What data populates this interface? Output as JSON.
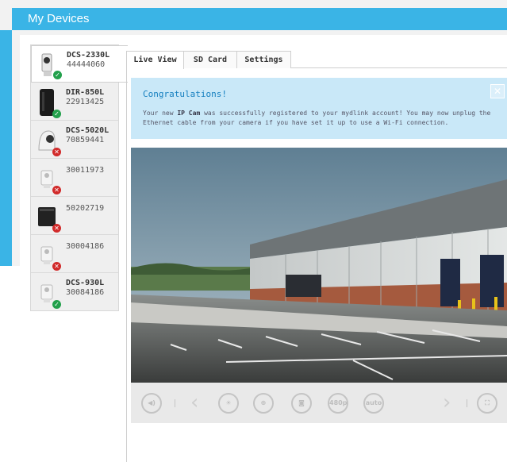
{
  "app": {
    "title": "My Devices"
  },
  "devices": [
    {
      "model": "DCS-2330L",
      "id": "44444060",
      "status": "online",
      "kind": "camera-white",
      "active": true
    },
    {
      "model": "DIR-850L",
      "id": "22913425",
      "status": "online",
      "kind": "router-black"
    },
    {
      "model": "DCS-5020L",
      "id": "70859441",
      "status": "offline",
      "kind": "camera-pt"
    },
    {
      "model": "",
      "id": "30011973",
      "status": "offline",
      "kind": "camera-cube"
    },
    {
      "model": "",
      "id": "50202719",
      "status": "offline",
      "kind": "nas-black"
    },
    {
      "model": "",
      "id": "30004186",
      "status": "offline",
      "kind": "camera-cube"
    },
    {
      "model": "DCS-930L",
      "id": "30084186",
      "status": "online",
      "kind": "camera-cube"
    }
  ],
  "tabs": [
    {
      "label": "Live View",
      "active": true
    },
    {
      "label": "SD Card"
    },
    {
      "label": "Settings"
    }
  ],
  "notice": {
    "title": "Congratulations!",
    "body_prefix": "Your new ",
    "body_bold": "IP Cam",
    "body_suffix": " was successfully registered to your mydlink account! You may now unplug the Ethernet cable from your camera if you have set it up to use a Wi-Fi connection.",
    "close_icon": "close-icon"
  },
  "video": {
    "scene": "warehouse-parking-lot"
  },
  "controls": {
    "resolution_label": "480p",
    "auto_label": "auto",
    "icons": [
      "volume-icon",
      "prev-icon",
      "brightness-icon",
      "zoom-icon",
      "snapshot-icon",
      "resolution-icon",
      "auto-icon",
      "next-icon",
      "fullscreen-icon"
    ]
  },
  "colors": {
    "header": "#3ab4e6",
    "notice_bg": "#c9e8f8",
    "online": "#22a04b",
    "offline": "#d12a2a"
  }
}
